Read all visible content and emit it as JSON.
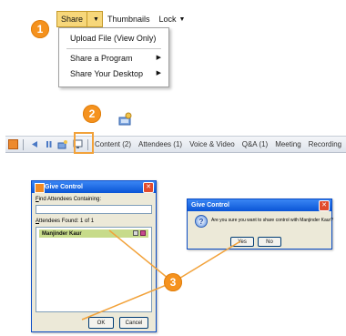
{
  "steps": {
    "one": "1",
    "two": "2",
    "three": "3"
  },
  "menubar": {
    "share_label": "Share",
    "thumbnails_label": "Thumbnails",
    "lock_label": "Lock"
  },
  "share_menu": {
    "upload": "Upload File (View Only)",
    "share_program": "Share a Program",
    "share_desktop": "Share Your Desktop"
  },
  "toolbar": {
    "tabs": [
      "Content (2)",
      "Attendees (1)",
      "Voice & Video",
      "Q&A (1)",
      "Meeting",
      "Recording"
    ]
  },
  "give_control": {
    "title": "Give Control",
    "find_label_u": "F",
    "find_label_rest": "ind Attendees Containing:",
    "search_value": "",
    "found_label_u": "A",
    "found_label_rest": "ttendees Found: 1 of 1",
    "attendee": "Manjinder Kaur",
    "ok": "OK",
    "cancel": "Cancel"
  },
  "confirm": {
    "title": "Give Control",
    "message": "Are you sure you want to share control with Manjinder Kaur?",
    "yes": "Yes",
    "no": "No"
  },
  "colors": {
    "badge": "#f5921e",
    "highlight": "#f2a23a",
    "menu_hover": "#f7d77a",
    "selected_row": "#c7db8a",
    "titlebar": "#0a55d6"
  }
}
